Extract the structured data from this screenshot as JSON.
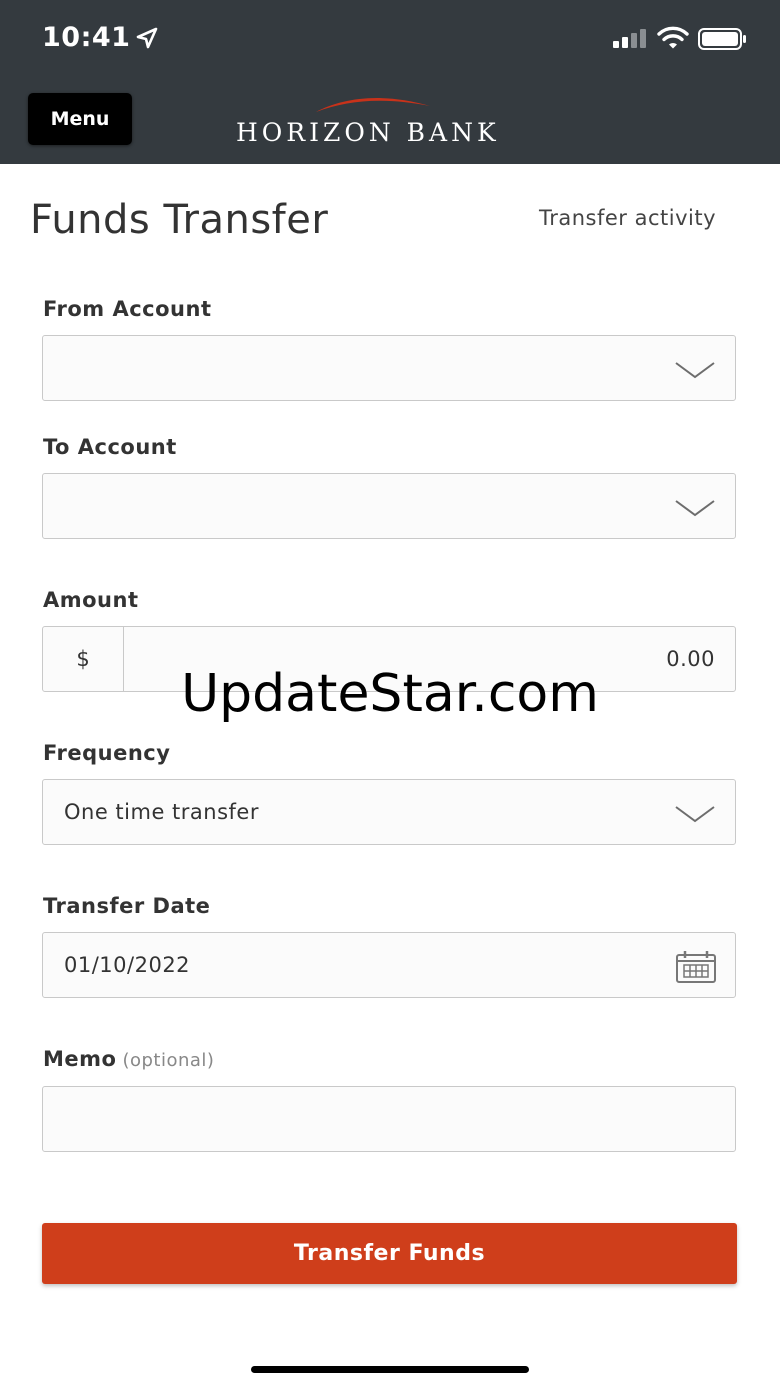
{
  "status_bar": {
    "time": "10:41",
    "icons": [
      "location-arrow-icon",
      "cellular-signal-icon",
      "wifi-icon",
      "battery-icon"
    ]
  },
  "header": {
    "menu_label": "Menu",
    "logo_text": "HORIZON BANK",
    "background_color": "#343a3f",
    "logo_accent_color": "#c8321a"
  },
  "page": {
    "title": "Funds Transfer",
    "activity_link": "Transfer activity"
  },
  "form": {
    "from_account": {
      "label": "From Account",
      "value": ""
    },
    "to_account": {
      "label": "To Account",
      "value": ""
    },
    "amount": {
      "label": "Amount",
      "currency_symbol": "$",
      "value": "0.00"
    },
    "frequency": {
      "label": "Frequency",
      "value": "One time transfer"
    },
    "transfer_date": {
      "label": "Transfer Date",
      "value": "01/10/2022"
    },
    "memo": {
      "label": "Memo",
      "hint": "(optional)",
      "value": ""
    },
    "submit_label": "Transfer Funds",
    "submit_color": "#cf3e1b"
  },
  "watermark": "UpdateStar.com"
}
